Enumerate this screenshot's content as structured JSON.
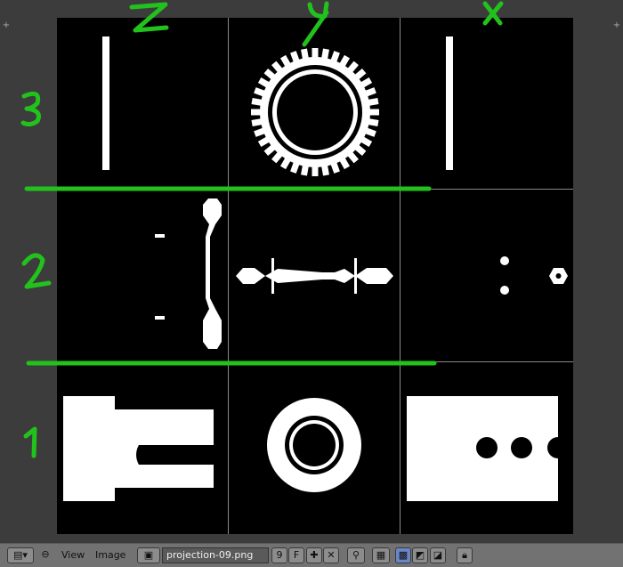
{
  "window": {
    "title": ""
  },
  "image_editor": {
    "image_name": "projection-09.png",
    "users": "9",
    "fake_user": "F"
  },
  "header": {
    "menus": [
      "View",
      "Image"
    ]
  },
  "annotations": {
    "col_labels": [
      "Z",
      "Y",
      "X"
    ],
    "row_labels": [
      "3",
      "2",
      "1"
    ]
  },
  "colors": {
    "annotation": "#22c21c",
    "background": "#000000",
    "shapes": "#ffffff",
    "header": "#727272"
  },
  "icons": [
    "editor-type-icon",
    "collapse-icon",
    "image-browse-icon",
    "new-image-icon",
    "unlink-icon",
    "pin-icon",
    "render-slot-icon",
    "alpha-checker-icon",
    "alpha-icon",
    "z-buffer-icon",
    "lock-icon"
  ]
}
